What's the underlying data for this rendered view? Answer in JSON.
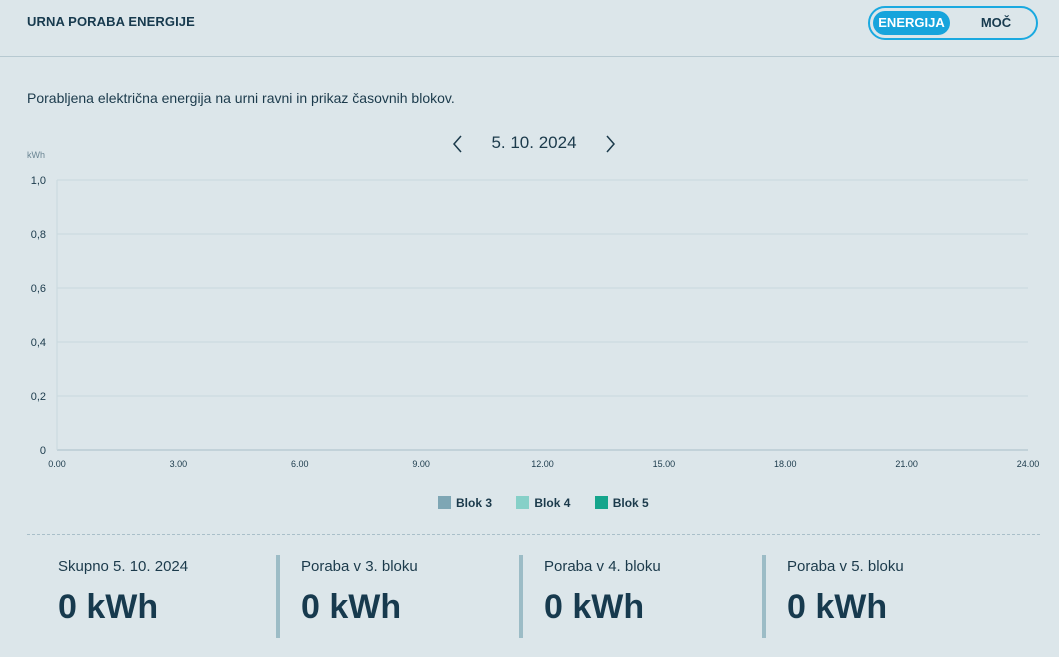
{
  "header": {
    "title": "URNA PORABA ENERGIJE",
    "toggle": {
      "active": "ENERGIJA",
      "inactive": "MOČ"
    }
  },
  "description": "Porabljena električna energija na urni ravni in prikaz časovnih blokov.",
  "date_nav": {
    "date": "5. 10. 2024",
    "prev_icon": "chevron-left-icon",
    "next_icon": "chevron-right-icon"
  },
  "chart_data": {
    "type": "bar",
    "ylabel": "kWh",
    "ylim": [
      0,
      1.0
    ],
    "y_ticks": [
      "1,0",
      "0,8",
      "0,6",
      "0,4",
      "0,2",
      "0"
    ],
    "x_ticks": [
      "0.00",
      "3.00",
      "6.00",
      "9.00",
      "12.00",
      "15.00",
      "18.00",
      "21.00",
      "24.00"
    ],
    "xlim": [
      0,
      24
    ],
    "grid": true,
    "series": [
      {
        "name": "Blok 3",
        "color": "#7ea6b4",
        "values": []
      },
      {
        "name": "Blok 4",
        "color": "#86d0c8",
        "values": []
      },
      {
        "name": "Blok 5",
        "color": "#15a58c",
        "values": []
      }
    ],
    "legend_position": "bottom-center"
  },
  "legend": [
    {
      "label": "Blok 3",
      "color": "#7ea6b4"
    },
    {
      "label": "Blok 4",
      "color": "#86d0c8"
    },
    {
      "label": "Blok 5",
      "color": "#15a58c"
    }
  ],
  "stats": [
    {
      "label": "Skupno 5. 10. 2024",
      "value": "0 kWh"
    },
    {
      "label": "Poraba v 3. bloku",
      "value": "0 kWh"
    },
    {
      "label": "Poraba v 4. bloku",
      "value": "0 kWh"
    },
    {
      "label": "Poraba v 5. bloku",
      "value": "0 kWh"
    }
  ],
  "colors": {
    "accent": "#17a4dc",
    "background": "#dce6ea",
    "text": "#173a4e"
  }
}
